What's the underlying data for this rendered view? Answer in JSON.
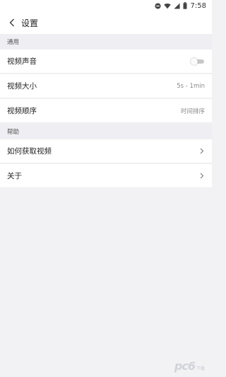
{
  "status_bar": {
    "time": "7:58",
    "icons": [
      "do-not-disturb-icon",
      "wifi-icon",
      "signal-icon",
      "battery-icon"
    ]
  },
  "header": {
    "title": "设置",
    "back_icon": "chevron-left-icon"
  },
  "sections": {
    "general": {
      "title": "通用",
      "items": [
        {
          "label": "视频声音",
          "control": "toggle",
          "toggle_on": false
        },
        {
          "label": "视频大小",
          "value": "5s - 1min"
        },
        {
          "label": "视频顺序",
          "value": "时间排序"
        }
      ]
    },
    "help": {
      "title": "帮助",
      "items": [
        {
          "label": "如何获取视频",
          "chevron_icon": "chevron-right-icon"
        },
        {
          "label": "关于",
          "chevron_icon": "chevron-right-icon"
        }
      ]
    }
  },
  "watermark": {
    "logo_text": "pc6",
    "sub_text": "下载"
  },
  "colors": {
    "background": "#f2f2f4",
    "section_background": "#efeff3",
    "row_background": "#ffffff",
    "secondary_text": "#888888"
  }
}
